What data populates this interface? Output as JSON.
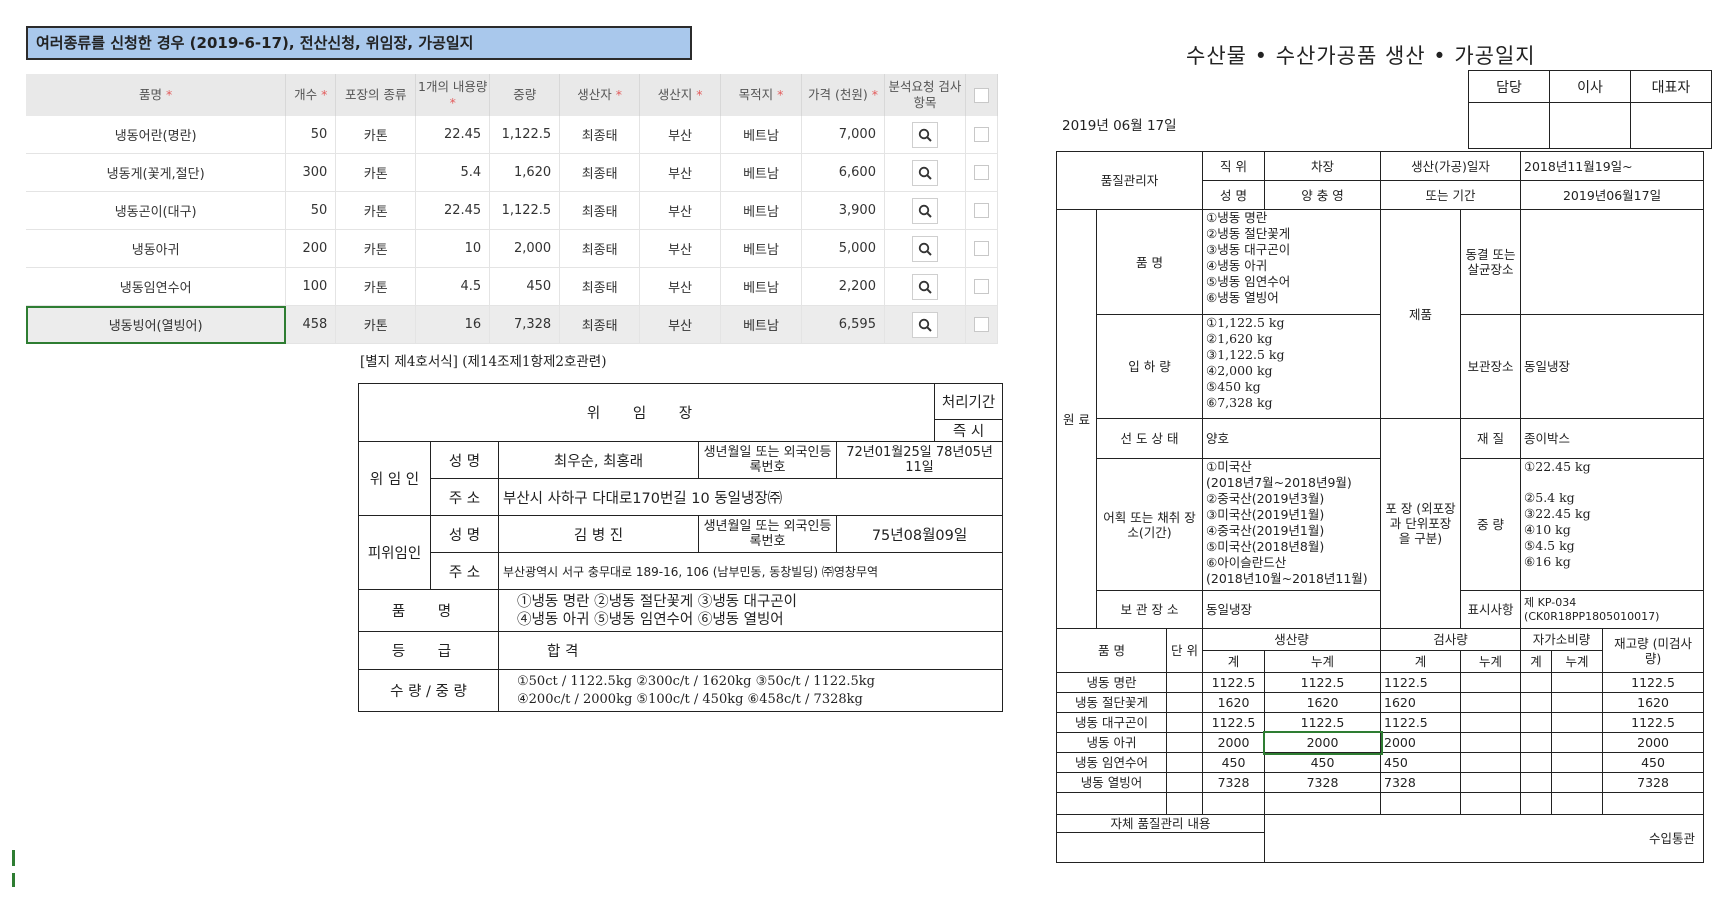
{
  "title_bar": "여러종류를 신청한 경우 (2019-6-17), 전산신청, 위임장, 가공일지",
  "product_table": {
    "headers": [
      "품명",
      "개수",
      "포장의 종류",
      "1개의 내용량",
      "중량",
      "생산자",
      "생산지",
      "목적지",
      "가격 (천원)",
      "분석요청 검사항목"
    ],
    "required_marker": "*",
    "rows": [
      [
        "냉동어란(명란)",
        "50",
        "카톤",
        "22.45",
        "1,122.5",
        "최종태",
        "부산",
        "베트남",
        "7,000"
      ],
      [
        "냉동게(꽃게,절단)",
        "300",
        "카톤",
        "5.4",
        "1,620",
        "최종태",
        "부산",
        "베트남",
        "6,600"
      ],
      [
        "냉동곤이(대구)",
        "50",
        "카톤",
        "22.45",
        "1,122.5",
        "최종태",
        "부산",
        "베트남",
        "3,900"
      ],
      [
        "냉동아귀",
        "200",
        "카톤",
        "10",
        "2,000",
        "최종태",
        "부산",
        "베트남",
        "5,000"
      ],
      [
        "냉동임연수어",
        "100",
        "카톤",
        "4.5",
        "450",
        "최종태",
        "부산",
        "베트남",
        "2,200"
      ],
      [
        "냉동빙어(열빙어)",
        "458",
        "카톤",
        "16",
        "7,328",
        "최종태",
        "부산",
        "베트남",
        "6,595"
      ]
    ]
  },
  "mandate": {
    "form_ref": "[별지 제4호서식] (제14조제1항제2호관련)",
    "title": "위 임 장",
    "period_label": "처리기간",
    "period_value": "즉 시",
    "delegator_label": "위 임 인",
    "delegate_label": "피위임인",
    "name_label": "성 명",
    "addr_label": "주 소",
    "birth_label": "생년월일 또는 외국인등록번호",
    "delegator_name": "최우순, 최홍래",
    "delegator_birth": "72년01월25일 78년05년11일",
    "delegator_addr": "부산시 사하구 다대로170번길 10 동일냉장㈜",
    "delegate_name": "김 병 진",
    "delegate_birth": "75년08월09일",
    "delegate_addr": "부산광역시 서구 충무대로 189-16, 106 (남부민동, 동창빌딩) ㈜영창무역",
    "item_label": "품 명",
    "items_line1": "①냉동 명란   ②냉동 절단꽃게   ③냉동 대구곤이",
    "items_line2": "④냉동 아귀   ⑤냉동 임연수어   ⑥냉동 열빙어",
    "grade_label": "등 급",
    "grade_value": "합 격",
    "qty_label": "수 량 / 중 량",
    "qty_line1": "①50ct / 1122.5kg  ②300c/t / 1620kg  ③50c/t / 1122.5kg",
    "qty_line2": "④200c/t / 2000kg  ⑤100c/t / 450kg  ⑥458c/t / 7328kg"
  },
  "log": {
    "title": "수산물 • 수산가공품 생산 • 가공일지",
    "sign_headers": [
      "담당",
      "이사",
      "대표자"
    ],
    "date": "2019년 06월 17일",
    "qc_label": "품질관리자",
    "position_label": "직 위",
    "position_value": "차장",
    "name_label": "성 명",
    "name_value": "양 충 영",
    "period_label_1": "생산(가공)일자",
    "period_label_2": "또는 기간",
    "period_value_1": "2018년11월19일~",
    "period_value_2": "2019년06월17일",
    "raw_label": "원 료",
    "product_name_label": "품 명",
    "product_names": [
      "①냉동 명란",
      "②냉동 절단꽃게",
      "③냉동 대구곤이",
      "④냉동 아귀",
      "⑤냉동 임연수어",
      "⑥냉동 열빙어"
    ],
    "intake_label": "입 하 량",
    "intake": [
      "①1,122.5 kg",
      "②1,620 kg",
      "③1,122.5 kg",
      "④2,000 kg",
      "⑤450 kg",
      "⑥7,328 kg"
    ],
    "fresh_label": "선 도 상 태",
    "fresh_value": "양호",
    "origin_label": "어획 또는 채취 장소(기간)",
    "origin": [
      "①미국산",
      "(2018년7월~2018년9월)",
      "②중국산(2019년3월)",
      "③미국산(2019년1월)",
      "④중국산(2019년1월)",
      "⑤미국산(2018년8월)",
      "⑥아이슬란드산",
      "(2018년10월~2018년11월)"
    ],
    "storage_label": "보 관 장 소",
    "storage_value": "동일냉장",
    "product_label": "제품",
    "freeze_label": "동결 또는 살균장소",
    "keep_label": "보관장소",
    "keep_value": "동일냉장",
    "material_label": "재 질",
    "material_value": "종이박스",
    "pack_label": "포 장 (외포장과 단위포장 을 구분)",
    "weight_label": "중 량",
    "weights": [
      "①22.45 kg",
      "",
      "②5.4 kg",
      "③22.45 kg",
      "④10 kg",
      "⑤4.5 kg",
      "⑥16 kg"
    ],
    "mark_label": "표시사항",
    "mark_value_1": "제 KP-034",
    "mark_value_2": "(CK0R18PP1805010017)",
    "prod_headers": {
      "name": "품 명",
      "unit": "단 위",
      "production": "생산량",
      "inspection": "검사량",
      "self_use": "자가소비량",
      "stock": "재고량 (미검사량)",
      "sum": "계",
      "cum": "누계"
    },
    "prod_rows": [
      [
        "냉동 명란",
        "1122.5",
        "1122.5",
        "1122.5",
        "1122.5"
      ],
      [
        "냉동 절단꽃게",
        "1620",
        "1620",
        "1620",
        "1620"
      ],
      [
        "냉동 대구곤이",
        "1122.5",
        "1122.5",
        "1122.5",
        "1122.5"
      ],
      [
        "냉동 아귀",
        "2000",
        "2000",
        "2000",
        "2000"
      ],
      [
        "냉동 임연수어",
        "450",
        "450",
        "450",
        "450"
      ],
      [
        "냉동 열빙어",
        "7328",
        "7328",
        "7328",
        "7328"
      ]
    ],
    "self_qc_label": "자체 품질관리 내용",
    "import_label": "수입통관"
  }
}
